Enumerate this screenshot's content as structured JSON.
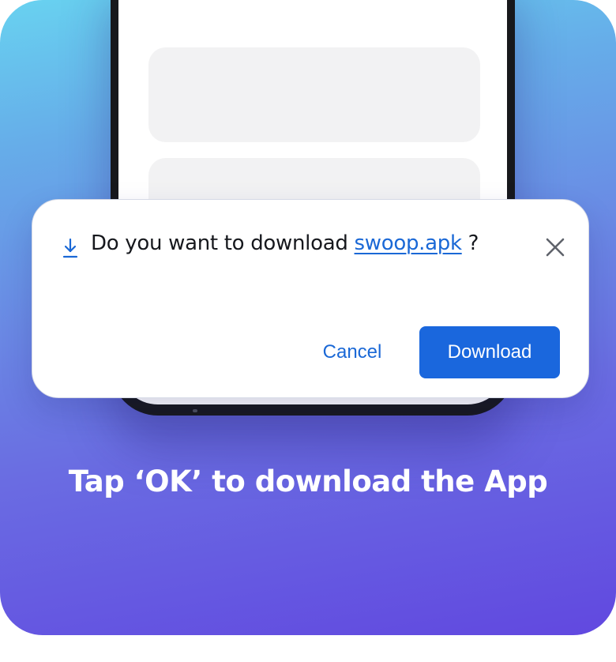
{
  "dialog": {
    "question_prefix": "Do you want to download ",
    "filename": "swoop.apk",
    "question_suffix": " ?",
    "cancel_label": "Cancel",
    "download_label": "Download",
    "icons": [
      "download-arrow-icon",
      "close-icon"
    ]
  },
  "caption": {
    "text": "Tap ‘OK’ to download the App"
  },
  "colors": {
    "accent": "#1a67dd",
    "link": "#1a68d6",
    "gradient_top": "#68d2f0",
    "gradient_bottom": "#6148e0"
  }
}
